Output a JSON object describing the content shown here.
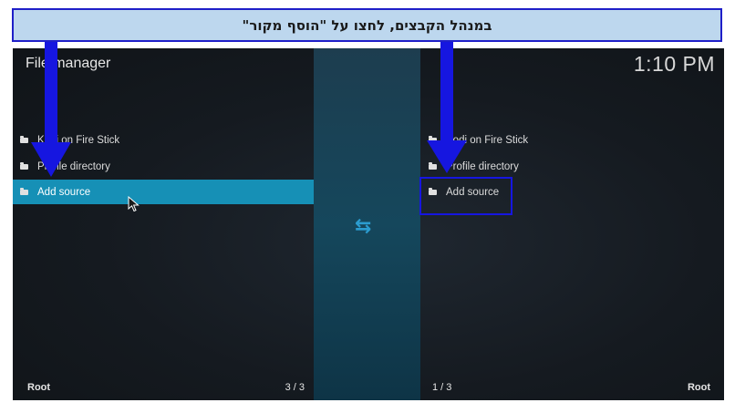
{
  "banner": {
    "text": "במנהל הקבצים, לחצו על \"הוסף מקור\""
  },
  "app": {
    "title": "File manager",
    "clock": "1:10 PM"
  },
  "left_panel": {
    "items": [
      {
        "label": "Kodi on Fire Stick",
        "icon": "folder-icon",
        "selected": false
      },
      {
        "label": "Profile directory",
        "icon": "folder-icon",
        "selected": false
      },
      {
        "label": "Add source",
        "icon": "folder-icon",
        "selected": true
      }
    ],
    "footer_label": "Root",
    "footer_count": "3 / 3"
  },
  "right_panel": {
    "items": [
      {
        "label": "Kodi on Fire Stick",
        "icon": "folder-icon"
      },
      {
        "label": "Profile directory",
        "icon": "folder-icon"
      },
      {
        "label": "Add source",
        "icon": "folder-icon"
      }
    ],
    "footer_label": "Root",
    "footer_count": "1 / 3"
  },
  "swap_icon": {
    "glyph": "⇆",
    "icon": "swap-arrows-icon"
  },
  "colors": {
    "accent": "#1690b6",
    "annotation": "#1616e0",
    "banner_bg": "#bdd7ee"
  }
}
